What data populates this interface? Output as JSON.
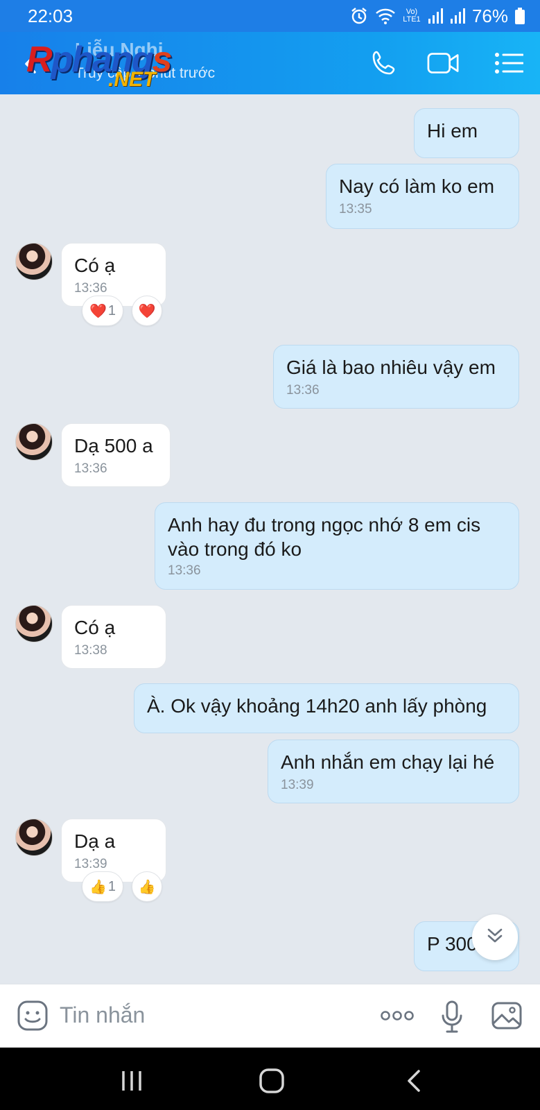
{
  "status_bar": {
    "time": "22:03",
    "battery": "76%",
    "network_label": "Vo) LTE1"
  },
  "header": {
    "contact_name": "Liễu Nghi",
    "contact_status": "Truy cập 1 phút trước",
    "watermark_main": "Rphangs",
    "watermark_sub": ".NET"
  },
  "messages": [
    {
      "direction": "out",
      "text": "Hi em",
      "time": ""
    },
    {
      "direction": "out",
      "text": "Nay có làm ko em",
      "time": "13:35"
    },
    {
      "direction": "in",
      "text": "Có ạ",
      "time": "13:36",
      "reactions": [
        {
          "emoji": "❤️",
          "count": "1"
        },
        {
          "emoji": "❤️",
          "count": ""
        }
      ]
    },
    {
      "direction": "out",
      "text": "Giá là bao nhiêu vậy em",
      "time": "13:36"
    },
    {
      "direction": "in",
      "text": "Dạ 500 a",
      "time": "13:36"
    },
    {
      "direction": "out",
      "text": "Anh hay đu trong ngọc nhớ 8 em cis vào trong đó ko",
      "time": "13:36"
    },
    {
      "direction": "in",
      "text": "Có ạ",
      "time": "13:38"
    },
    {
      "direction": "out",
      "text": "À. Ok vậy khoảng 14h20 anh lấy phòng",
      "time": ""
    },
    {
      "direction": "out",
      "text": "Anh nhắn em chạy lại hé",
      "time": "13:39"
    },
    {
      "direction": "in",
      "text": "Dạ a",
      "time": "13:39",
      "reactions": [
        {
          "emoji": "👍",
          "count": "1"
        },
        {
          "emoji": "👍",
          "count": ""
        }
      ]
    },
    {
      "direction": "out",
      "text": "P 300",
      "time": ""
    }
  ],
  "input": {
    "placeholder": "Tin nhắn"
  },
  "colors": {
    "header_start": "#1780ea",
    "header_end": "#18b4f6",
    "bubble_out": "#d4ecfc",
    "bubble_in": "#ffffff",
    "chat_bg": "#e3e8ee"
  },
  "icons": {
    "header": [
      "back-icon",
      "phone-icon",
      "video-call-icon",
      "menu-list-icon"
    ],
    "input_bar": [
      "sticker-icon",
      "more-options-icon",
      "microphone-icon",
      "image-icon"
    ],
    "nav": [
      "recent-apps-icon",
      "home-icon",
      "nav-back-icon"
    ]
  }
}
